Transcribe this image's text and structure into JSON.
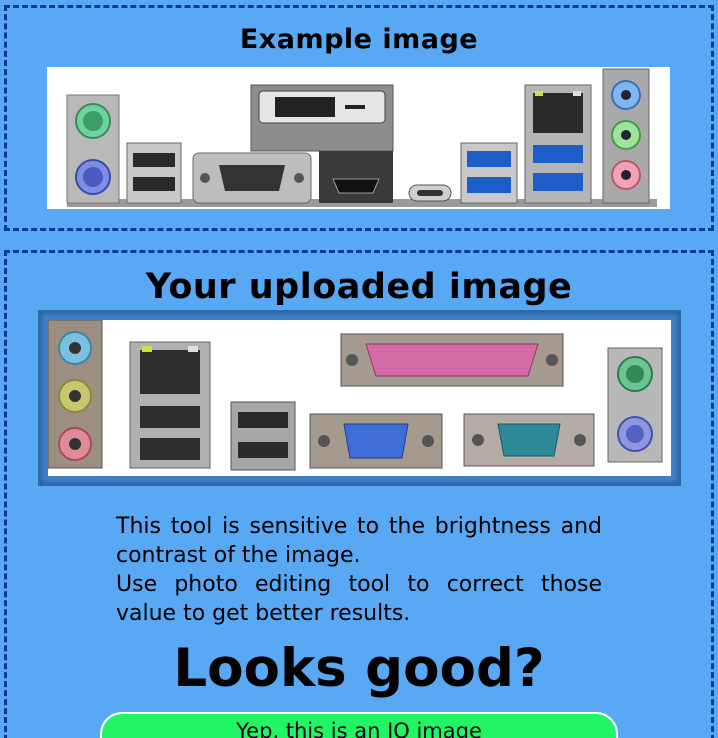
{
  "example_section": {
    "title": "Example image"
  },
  "upload_section": {
    "title": "Your uploaded image",
    "notice_line_1": "This tool is sensitive to the brightness and contrast of the image.",
    "notice_line_2": "Use photo editing tool to correct those value to get better results.",
    "verdict": "Looks good?",
    "confirm_button_label": "Yep, this is an IO image"
  },
  "colors": {
    "page_background": "#58a8f4",
    "panel_border": "#0a3a8c",
    "confirm_button": "#22f565"
  },
  "icons": {
    "example_ports": [
      "ps2-port-icon",
      "usb-port-icon",
      "vga-port-icon",
      "dvi-port-icon",
      "hdmi-port-icon",
      "usb-c-port-icon",
      "ethernet-port-icon",
      "audio-jack-icon"
    ],
    "uploaded_ports": [
      "audio-jack-icon",
      "ethernet-port-icon",
      "usb-port-icon",
      "parallel-port-icon",
      "vga-port-icon",
      "serial-port-icon",
      "ps2-port-icon"
    ]
  }
}
